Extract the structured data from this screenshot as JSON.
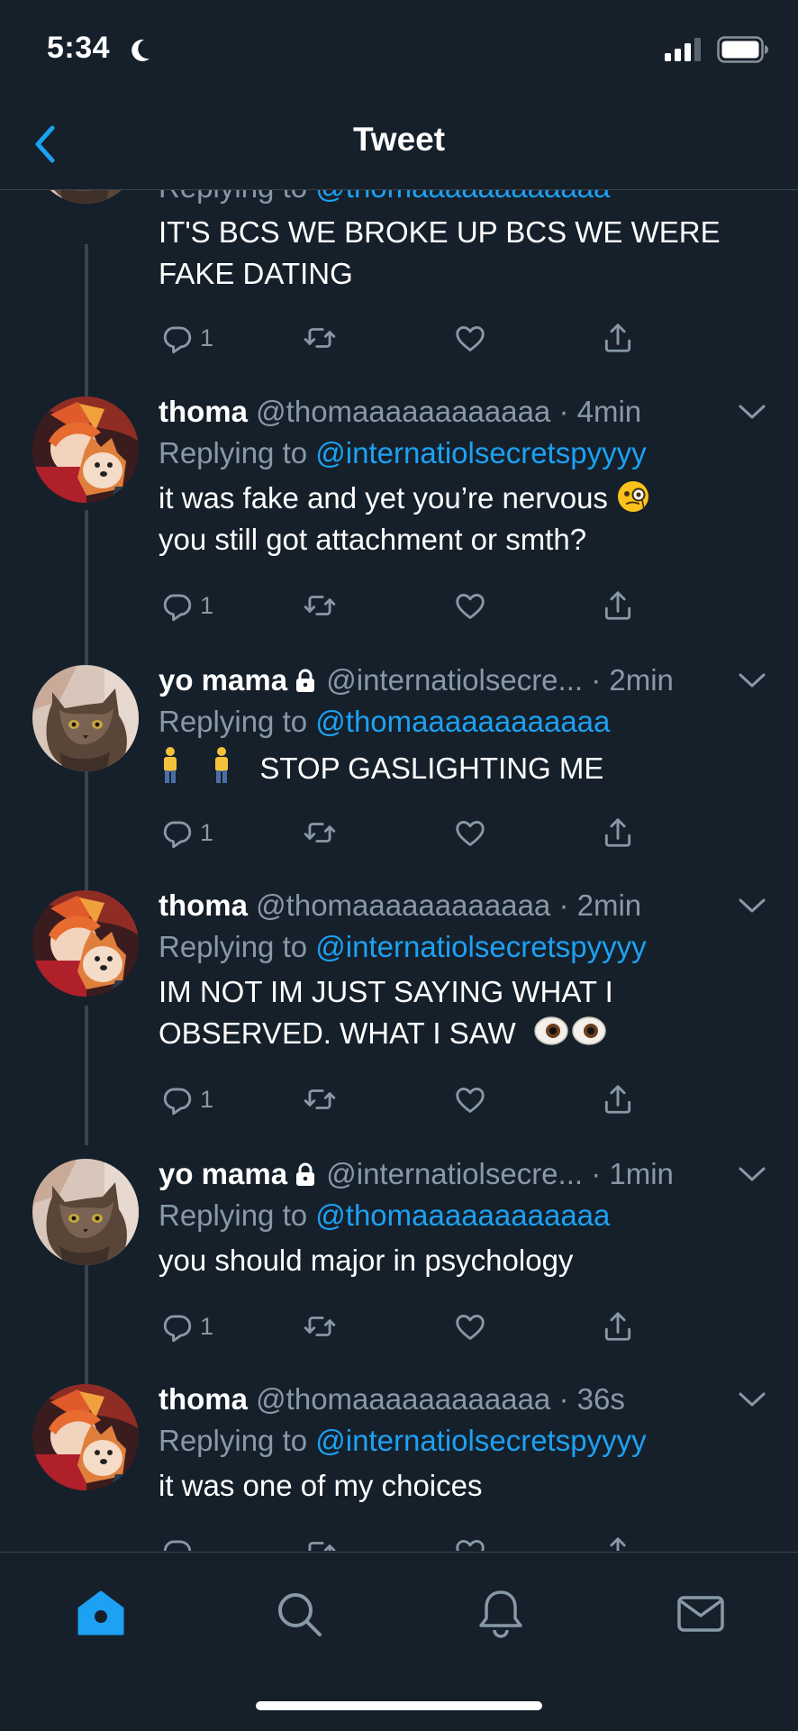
{
  "status": {
    "time": "5:34"
  },
  "header": {
    "title": "Tweet"
  },
  "top_tweet": {
    "reply_prefix": "Replying to",
    "reply_mention": "@thomaaaaaaaaaaaa",
    "text": "IT'S BCS WE BROKE UP BCS WE WERE FAKE DATING",
    "reply_count": "1"
  },
  "tweets": [
    {
      "name": "thoma",
      "handle": "@thomaaaaaaaaaaaa",
      "time": "· 4min",
      "reply_prefix": "Replying to",
      "reply_mention": "@internatiolsecretspyyyy",
      "text_line1": "it was fake and yet you’re nervous",
      "text_line2": "you still got attachment or smth?",
      "reply_count": "1"
    },
    {
      "name": "yo mama",
      "handle": "@internatiolsecre...",
      "time": "· 2min",
      "reply_prefix": "Replying to",
      "reply_mention": "@thomaaaaaaaaaaaa",
      "text_line1": "STOP GASLIGHTING ME",
      "reply_count": "1"
    },
    {
      "name": "thoma",
      "handle": "@thomaaaaaaaaaaaa",
      "time": "· 2min",
      "reply_prefix": "Replying to",
      "reply_mention": "@internatiolsecretspyyyy",
      "text_line1": "IM NOT IM JUST SAYING WHAT I",
      "text_line2": "OBSERVED. WHAT I SAW",
      "reply_count": "1"
    },
    {
      "name": "yo mama",
      "handle": "@internatiolsecre...",
      "time": "· 1min",
      "reply_prefix": "Replying to",
      "reply_mention": "@thomaaaaaaaaaaaa",
      "text_line1": "you should major in psychology",
      "reply_count": "1"
    },
    {
      "name": "thoma",
      "handle": "@thomaaaaaaaaaaaa",
      "time": "· 36s",
      "reply_prefix": "Replying to",
      "reply_mention": "@internatiolsecretspyyyy",
      "text_line1": "it was one of my choices"
    }
  ],
  "icons": {
    "reply": "reply-icon",
    "retweet": "retweet-icon",
    "like": "heart-icon",
    "share": "share-icon",
    "lock": "lock-icon",
    "caret": "chevron-down-icon",
    "back": "back-chevron-icon",
    "tabs": [
      "home-icon",
      "search-icon",
      "bell-icon",
      "mail-icon"
    ]
  },
  "colors": {
    "background": "#15202b",
    "accent": "#1da1f2",
    "secondary_text": "#8899a6",
    "divider": "#38444d"
  }
}
